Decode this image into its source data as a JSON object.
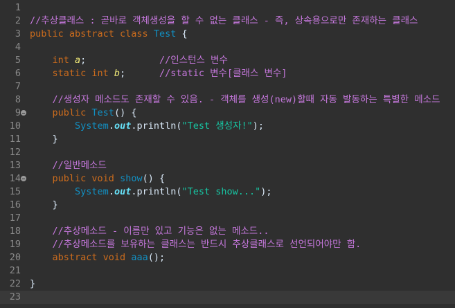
{
  "editor": {
    "lines": [
      {
        "n": "1",
        "fold": false,
        "tokens": []
      },
      {
        "n": "2",
        "fold": false,
        "tokens": [
          {
            "t": "cm",
            "v": "//추상클래스 : 곧바로 객체생성을 할 수 없는 클래스 - 즉, 상속용으로만 존재하는 클래스"
          }
        ]
      },
      {
        "n": "3",
        "fold": false,
        "tokens": [
          {
            "t": "kw",
            "v": "public abstract class "
          },
          {
            "t": "cls",
            "v": "Test"
          },
          {
            "t": "tx",
            "v": " {"
          }
        ]
      },
      {
        "n": "4",
        "fold": false,
        "tokens": []
      },
      {
        "n": "5",
        "fold": false,
        "tokens": [
          {
            "t": "tx",
            "v": "    "
          },
          {
            "t": "kw",
            "v": "int "
          },
          {
            "t": "var",
            "v": "a"
          },
          {
            "t": "tx",
            "v": ";             "
          },
          {
            "t": "cm",
            "v": "//인스턴스 변수"
          }
        ]
      },
      {
        "n": "6",
        "fold": false,
        "tokens": [
          {
            "t": "tx",
            "v": "    "
          },
          {
            "t": "kw",
            "v": "static int "
          },
          {
            "t": "var",
            "v": "b"
          },
          {
            "t": "tx",
            "v": ";      "
          },
          {
            "t": "cm",
            "v": "//static 변수[클래스 변수]"
          }
        ]
      },
      {
        "n": "7",
        "fold": false,
        "tokens": []
      },
      {
        "n": "8",
        "fold": false,
        "tokens": [
          {
            "t": "tx",
            "v": "    "
          },
          {
            "t": "cm",
            "v": "//생성자 메소드도 존재할 수 있음. - 객체를 생성(new)할때 자동 발동하는 특별한 메소드"
          }
        ]
      },
      {
        "n": "9",
        "fold": true,
        "tokens": [
          {
            "t": "tx",
            "v": "    "
          },
          {
            "t": "kw",
            "v": "public "
          },
          {
            "t": "cls",
            "v": "Test"
          },
          {
            "t": "tx",
            "v": "() {"
          }
        ]
      },
      {
        "n": "10",
        "fold": false,
        "tokens": [
          {
            "t": "tx",
            "v": "        "
          },
          {
            "t": "cls",
            "v": "System"
          },
          {
            "t": "tx",
            "v": "."
          },
          {
            "t": "fld",
            "v": "out"
          },
          {
            "t": "tx",
            "v": ".println("
          },
          {
            "t": "str",
            "v": "\"Test 생성자!\""
          },
          {
            "t": "tx",
            "v": ");"
          }
        ]
      },
      {
        "n": "11",
        "fold": false,
        "tokens": [
          {
            "t": "tx",
            "v": "    }"
          }
        ]
      },
      {
        "n": "12",
        "fold": false,
        "tokens": []
      },
      {
        "n": "13",
        "fold": false,
        "tokens": [
          {
            "t": "tx",
            "v": "    "
          },
          {
            "t": "cm",
            "v": "//일반메소드"
          }
        ]
      },
      {
        "n": "14",
        "fold": true,
        "tokens": [
          {
            "t": "tx",
            "v": "    "
          },
          {
            "t": "kw",
            "v": "public void "
          },
          {
            "t": "cls",
            "v": "show"
          },
          {
            "t": "tx",
            "v": "() {"
          }
        ]
      },
      {
        "n": "15",
        "fold": false,
        "tokens": [
          {
            "t": "tx",
            "v": "        "
          },
          {
            "t": "cls",
            "v": "System"
          },
          {
            "t": "tx",
            "v": "."
          },
          {
            "t": "fld",
            "v": "out"
          },
          {
            "t": "tx",
            "v": ".println("
          },
          {
            "t": "str",
            "v": "\"Test show...\""
          },
          {
            "t": "tx",
            "v": ");"
          }
        ]
      },
      {
        "n": "16",
        "fold": false,
        "tokens": [
          {
            "t": "tx",
            "v": "    }"
          }
        ]
      },
      {
        "n": "17",
        "fold": false,
        "tokens": []
      },
      {
        "n": "18",
        "fold": false,
        "tokens": [
          {
            "t": "tx",
            "v": "    "
          },
          {
            "t": "cm",
            "v": "//추상메소드 - 이름만 있고 기능은 없는 메소드.."
          }
        ]
      },
      {
        "n": "19",
        "fold": false,
        "tokens": [
          {
            "t": "tx",
            "v": "    "
          },
          {
            "t": "cm",
            "v": "//추상메소드를 보유하는 클래스는 반드시 추상클래스로 선언되어야만 함."
          }
        ]
      },
      {
        "n": "20",
        "fold": false,
        "tokens": [
          {
            "t": "tx",
            "v": "    "
          },
          {
            "t": "kw",
            "v": "abstract void "
          },
          {
            "t": "cls",
            "v": "aaa"
          },
          {
            "t": "tx",
            "v": "();"
          }
        ]
      },
      {
        "n": "21",
        "fold": false,
        "tokens": []
      },
      {
        "n": "22",
        "fold": false,
        "tokens": [
          {
            "t": "tx",
            "v": "}"
          }
        ]
      },
      {
        "n": "23",
        "fold": false,
        "current": true,
        "tokens": []
      }
    ]
  }
}
